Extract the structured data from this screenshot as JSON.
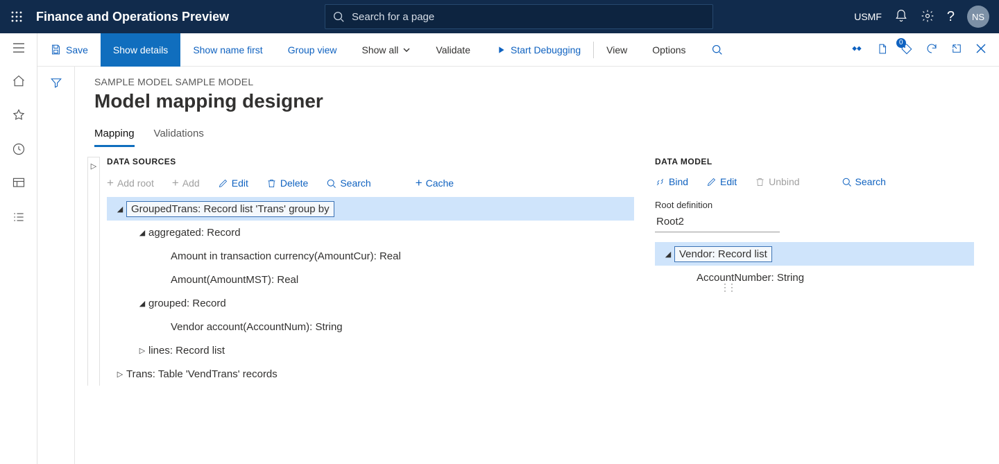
{
  "topbar": {
    "app_title": "Finance and Operations Preview",
    "search_placeholder": "Search for a page",
    "company": "USMF",
    "avatar_initials": "NS"
  },
  "cmdbar": {
    "save": "Save",
    "show_details": "Show details",
    "show_name_first": "Show name first",
    "group_view": "Group view",
    "show_all": "Show all",
    "validate": "Validate",
    "start_debugging": "Start Debugging",
    "view": "View",
    "options": "Options",
    "badge_count": "0"
  },
  "page": {
    "breadcrumb": "SAMPLE MODEL SAMPLE MODEL",
    "title": "Model mapping designer",
    "tabs": {
      "mapping": "Mapping",
      "validations": "Validations"
    }
  },
  "ds": {
    "heading": "DATA SOURCES",
    "toolbar": {
      "add_root": "Add root",
      "add": "Add",
      "edit": "Edit",
      "delete": "Delete",
      "search": "Search",
      "cache": "Cache"
    },
    "tree": {
      "n0": "GroupedTrans: Record list 'Trans' group by",
      "n1": "aggregated: Record",
      "n2": "Amount in transaction currency(AmountCur): Real",
      "n3": "Amount(AmountMST): Real",
      "n4": "grouped: Record",
      "n5": "Vendor account(AccountNum): String",
      "n6": "lines: Record list",
      "n7": "Trans: Table 'VendTrans' records"
    }
  },
  "dm": {
    "heading": "DATA MODEL",
    "toolbar": {
      "bind": "Bind",
      "edit": "Edit",
      "unbind": "Unbind",
      "search": "Search"
    },
    "root_def_label": "Root definition",
    "root_def_value": "Root2",
    "tree": {
      "n0": "Vendor: Record list",
      "n1": "AccountNumber: String"
    }
  }
}
